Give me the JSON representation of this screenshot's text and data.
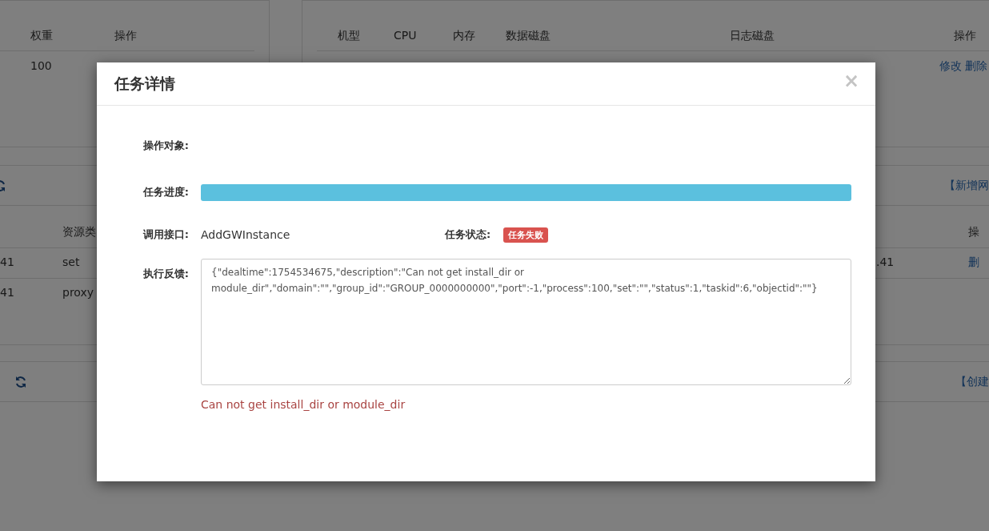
{
  "background": {
    "weight_table": {
      "columns": [
        "权重",
        "操作"
      ],
      "rows": [
        [
          "100"
        ]
      ]
    },
    "machine_table": {
      "columns": [
        "机型",
        "CPU",
        "内存",
        "数据磁盘",
        "日志磁盘",
        "操作"
      ],
      "row_actions": [
        "修改",
        "删除"
      ]
    },
    "section_one": {
      "action": "【新增网"
    },
    "resource_table": {
      "columns": [
        "资源类",
        "操"
      ],
      "rows": [
        {
          "column_1": "41",
          "type": "set",
          "column_3": ".41",
          "action": "删"
        },
        {
          "column_1": "41",
          "type": "proxy"
        }
      ]
    },
    "section_two": {
      "action": "【创建"
    }
  },
  "modal": {
    "title": "任务详情",
    "close": "×",
    "target_label": "操作对象:",
    "progress_label": "任务进度:",
    "progress": {
      "level": 1
    },
    "api_label": "调用接口:",
    "api": "AddGWInstance",
    "status_label": "任务状态:",
    "status": {
      "text": "任务失败",
      "kind": "failed"
    },
    "feedback_label": "执行反馈:",
    "feedback": "{\"dealtime\":1754534675,\"description\":\"Can not get install_dir or module_dir\",\"domain\":\"\",\"group_id\":\"GROUP_0000000000\",\"port\":-1,\"process\":100,\"set\":\"\",\"status\":1,\"taskid\":6,\"objectid\":\"\"}",
    "error": "Can not get install_dir or module_dir"
  }
}
